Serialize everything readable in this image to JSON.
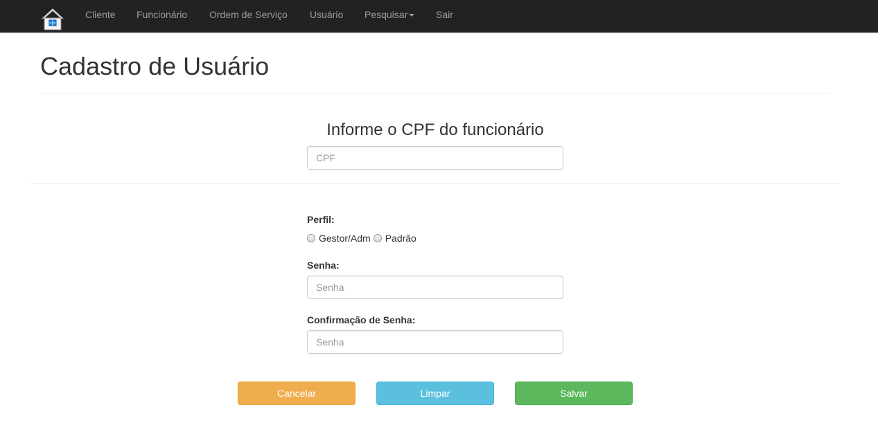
{
  "navbar": {
    "brand_icon": "home-icon",
    "items": [
      {
        "label": "Cliente"
      },
      {
        "label": "Funcionário"
      },
      {
        "label": "Ordem de Serviço"
      },
      {
        "label": "Usuário"
      },
      {
        "label": "Pesquisar"
      },
      {
        "label": "Sair"
      }
    ]
  },
  "page": {
    "title": "Cadastro de Usuário"
  },
  "cpf_section": {
    "heading": "Informe o CPF do funcionário",
    "cpf_placeholder": "CPF",
    "cpf_value": ""
  },
  "form": {
    "perfil_label": "Perfil:",
    "perfil_options": [
      {
        "label": "Gestor/Adm",
        "checked": false
      },
      {
        "label": "Padrão",
        "checked": false
      }
    ],
    "senha_label": "Senha:",
    "senha_placeholder": "Senha",
    "confirmacao_label": "Confirmação de Senha:",
    "confirmacao_placeholder": "Senha"
  },
  "actions": {
    "cancel_label": "Cancelar",
    "clear_label": "Limpar",
    "save_label": "Salvar"
  },
  "colors": {
    "navbar_bg": "#222222",
    "nav_text": "#9d9d9d",
    "warning": "#f0ad4e",
    "info": "#5bc0de",
    "success": "#5cb85c"
  }
}
